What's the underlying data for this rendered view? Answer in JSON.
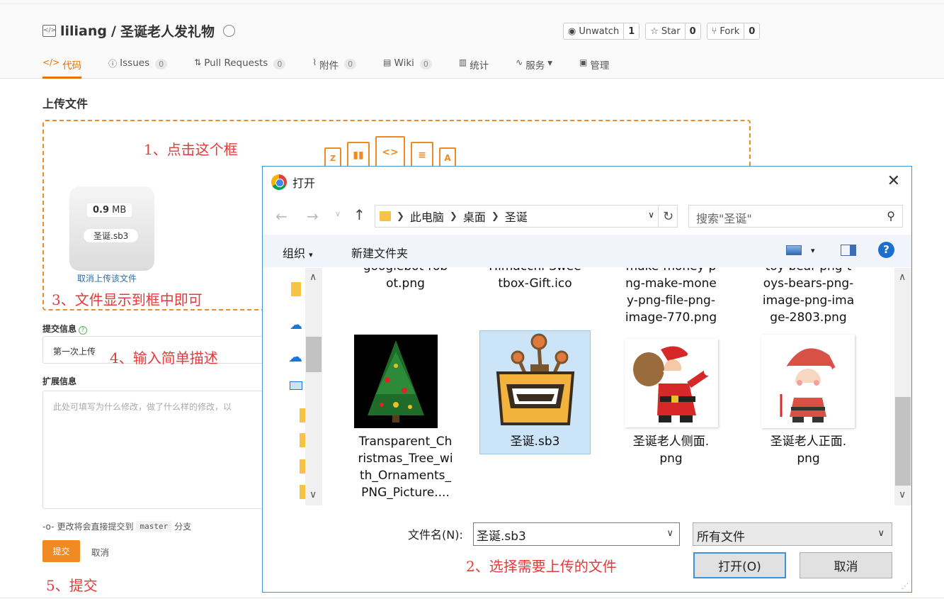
{
  "repo": {
    "owner": "liliang",
    "separator": " / ",
    "name": "圣诞老人发礼物",
    "actions": [
      {
        "label": "Unwatch",
        "count": "1",
        "icon": "eye-icon"
      },
      {
        "label": "Star",
        "count": "0",
        "icon": "star-icon"
      },
      {
        "label": "Fork",
        "count": "0",
        "icon": "fork-icon"
      }
    ]
  },
  "tabs": [
    {
      "label": "代码",
      "icon": "code-icon",
      "count": null,
      "active": true
    },
    {
      "label": "Issues",
      "icon": "issue-icon",
      "count": "0"
    },
    {
      "label": "Pull Requests",
      "icon": "pull-request-icon",
      "count": "0"
    },
    {
      "label": "附件",
      "icon": "paperclip-icon",
      "count": "0"
    },
    {
      "label": "Wiki",
      "icon": "book-icon",
      "count": "0"
    },
    {
      "label": "统计",
      "icon": "bar-chart-icon",
      "count": null
    },
    {
      "label": "服务",
      "icon": "pulse-icon",
      "count": null,
      "dropdown": "▾"
    },
    {
      "label": "管理",
      "icon": "clipboard-icon",
      "count": null
    }
  ],
  "upload": {
    "title": "上传文件",
    "file_size_value": "0.9",
    "file_size_unit": "MB",
    "file_name": "圣诞.sb3",
    "cancel_link": "取消上传该文件"
  },
  "form": {
    "commit_label": "提交信息",
    "commit_value": "第一次上传",
    "extended_label": "扩展信息",
    "extended_placeholder": "此处可填写为什么修改，做了什么样的修改，以",
    "branch_prefix": "更改将会直接提交到",
    "branch_name": "master",
    "branch_suffix": "分支",
    "submit": "提交",
    "cancel": "取消"
  },
  "annotations": {
    "step1": "1、点击这个框",
    "step2": "2、选择需要上传的文件",
    "step3": "3、文件显示到框中即可",
    "step4": "4、输入简单描述",
    "step5": "5、提交"
  },
  "dialog": {
    "title": "打开",
    "breadcrumb": [
      "此电脑",
      "桌面",
      "圣诞"
    ],
    "search_placeholder": "搜索\"圣诞\"",
    "organize": "组织",
    "new_folder": "新建文件夹",
    "files_top": [
      {
        "lines": [
          "googlebot-rob",
          "ot.png"
        ]
      },
      {
        "lines": [
          "Himacchi-Swee",
          "tbox-Gift.ico"
        ]
      },
      {
        "lines": [
          "make-money-p",
          "ng-make-mone",
          "y-png-file-png-",
          "image-770.png"
        ]
      },
      {
        "lines": [
          "toy-bear-png-t",
          "oys-bears-png-",
          "image-png-ima",
          "ge-2803.png"
        ]
      }
    ],
    "files_bottom": [
      {
        "lines": [
          "Transparent_Ch",
          "ristmas_Tree_wi",
          "th_Ornaments_",
          "PNG_Picture...."
        ],
        "thumb": "tree-thumbnail"
      },
      {
        "lines": [
          "圣诞.sb3"
        ],
        "thumb": "scratch-file-thumbnail",
        "selected": true
      },
      {
        "lines": [
          "圣诞老人侧面.",
          "png"
        ],
        "thumb": "santa-side-thumbnail"
      },
      {
        "lines": [
          "圣诞老人正面.",
          "png"
        ],
        "thumb": "santa-front-thumbnail"
      }
    ],
    "filename_label": "文件名(N):",
    "filename_value": "圣诞.sb3",
    "filetype": "所有文件",
    "open_button": "打开(O)",
    "cancel_button": "取消"
  },
  "colors": {
    "accent": "#f08a24",
    "annotation": "#e23b3b",
    "dialog_border": "#3e93d6",
    "selection": "#cce4f7"
  }
}
